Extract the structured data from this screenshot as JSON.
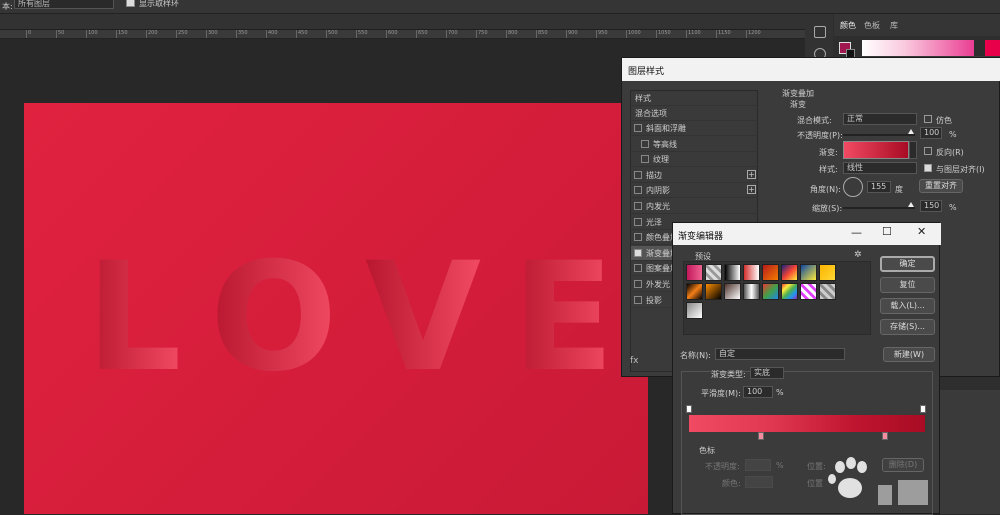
{
  "options_bar": {
    "label": "本:",
    "dropdown": "所有图层",
    "checkbox_label": "显示取样环"
  },
  "ruler": {
    "numbers": [
      "0",
      "50",
      "100",
      "150",
      "200",
      "250",
      "300",
      "350",
      "400",
      "450",
      "500",
      "550",
      "600",
      "650",
      "700",
      "750",
      "800",
      "850",
      "900",
      "950",
      "1000",
      "1050",
      "1100",
      "1150",
      "1200"
    ]
  },
  "canvas": {
    "text": [
      "L",
      "O",
      "V",
      "E"
    ]
  },
  "color_panel": {
    "tabs": [
      "颜色",
      "色板",
      "库"
    ],
    "fg": "#a0164f",
    "hue": "#e8004a"
  },
  "layer_style": {
    "title": "图层样式",
    "styles_header": "样式",
    "blend_options": "混合选项",
    "items": [
      {
        "label": "斜面和浮雕",
        "checked": false,
        "plus": false
      },
      {
        "label": "等高线",
        "checked": false,
        "plus": false
      },
      {
        "label": "纹理",
        "checked": false,
        "plus": false
      },
      {
        "label": "描边",
        "checked": false,
        "plus": true
      },
      {
        "label": "内阴影",
        "checked": false,
        "plus": true
      },
      {
        "label": "内发光",
        "checked": false,
        "plus": false
      },
      {
        "label": "光泽",
        "checked": false,
        "plus": false
      },
      {
        "label": "颜色叠加",
        "checked": false,
        "plus": true
      },
      {
        "label": "渐变叠加",
        "checked": true,
        "plus": true
      },
      {
        "label": "图案叠加",
        "checked": false,
        "plus": false
      },
      {
        "label": "外发光",
        "checked": false,
        "plus": false
      },
      {
        "label": "投影",
        "checked": false,
        "plus": true
      }
    ],
    "fx": "fx",
    "gradient_overlay": {
      "section": "渐变叠加",
      "subsection": "渐变",
      "blend_mode_label": "混合模式:",
      "blend_mode": "正常",
      "dither": "仿色",
      "opacity_label": "不透明度(P):",
      "opacity": "100",
      "pct": "%",
      "gradient_label": "渐变:",
      "reverse": "反向(R)",
      "style_label": "样式:",
      "style": "线性",
      "align": "与图层对齐(I)",
      "angle_label": "角度(N):",
      "angle": "155",
      "degree": "度",
      "reset_align": "重置对齐",
      "scale_label": "缩放(S):",
      "scale": "150",
      "scale_pct": "%"
    }
  },
  "gradient_editor": {
    "title": "渐变编辑器",
    "presets_label": "预设",
    "ok": "确定",
    "reset": "复位",
    "load": "载入(L)...",
    "save": "存储(S)...",
    "name_label": "名称(N):",
    "name": "自定",
    "new": "新建(W)",
    "type_label": "渐变类型:",
    "type": "实底",
    "smooth_label": "平滑度(M):",
    "smooth": "100",
    "smooth_pct": "%",
    "color_stops": "色标",
    "opacity_label": "不透明度:",
    "opacity_pct": "%",
    "location_label": "位置:",
    "delete": "删除(D)",
    "color_label": "颜色:",
    "location2_label": "位置"
  }
}
